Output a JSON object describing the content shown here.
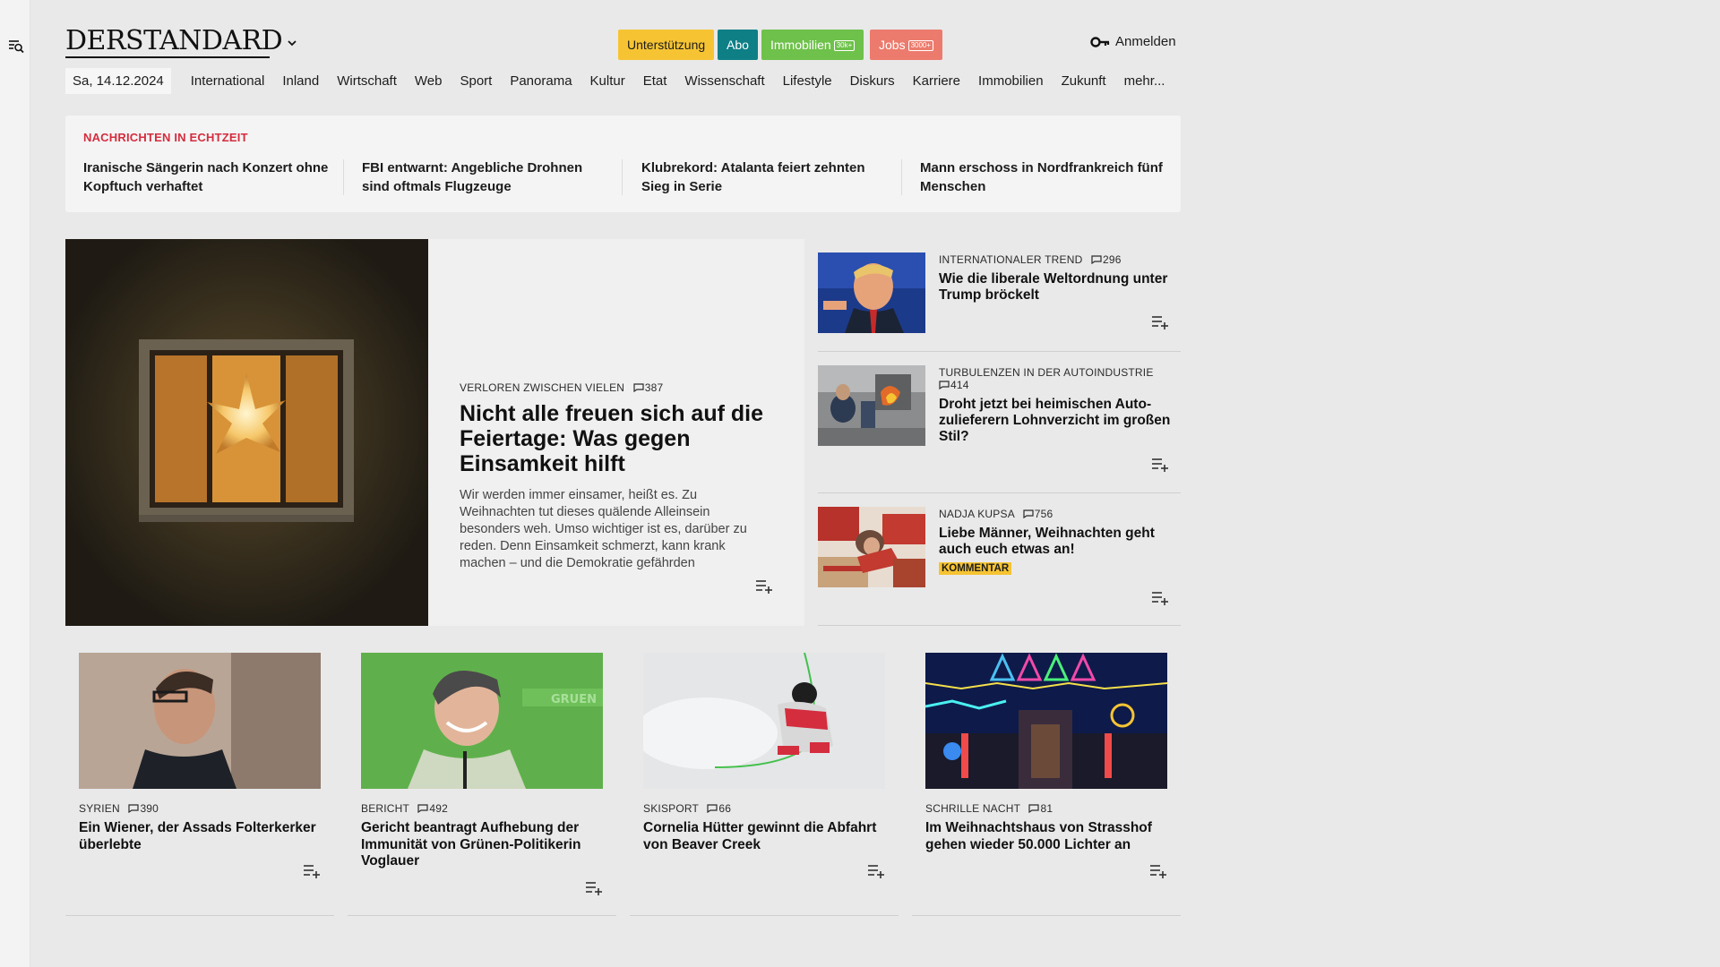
{
  "header": {
    "logo": "DERSTANDARD",
    "promos": {
      "support": "Unterstützung",
      "abo": "Abo",
      "immo": "Immobilien",
      "immo_badge": "30k+",
      "jobs": "Jobs",
      "jobs_badge": "3000+"
    },
    "login": "Anmelden"
  },
  "nav": {
    "date": "Sa, 14.12.2024",
    "items": [
      "International",
      "Inland",
      "Wirtschaft",
      "Web",
      "Sport",
      "Panorama",
      "Kultur",
      "Etat",
      "Wissenschaft",
      "Lifestyle",
      "Diskurs",
      "Karriere",
      "Immobilien",
      "Zukunft",
      "mehr..."
    ]
  },
  "ticker": {
    "heading": "Nachrichten in Echtzeit",
    "items": [
      "Iranische Sängerin nach Konzert ohne Kopftuch verhaftet",
      "FBI entwarnt: Angebliche Drohnen sind oftmals Flugzeuge",
      "Klubrekord: Atalanta feiert zehnten Sieg in Serie",
      "Mann erschoss in Nordfrankreich fünf Menschen"
    ]
  },
  "hero": {
    "kicker": "Verloren zwischen vielen",
    "comments": "387",
    "title": "Nicht alle freuen sich auf die Feiertage: Was gegen Einsamkeit hilft",
    "teaser": "Wir werden immer einsamer, heißt es. Zu Weihnachten tut dieses quälende Alleinsein besonders weh. Umso wichtiger ist es, darüber zu reden. Denn Einsamkeit schmerzt, kann krank machen – und die Demokratie gefährden"
  },
  "side": [
    {
      "kicker": "Internationaler Trend",
      "comments": "296",
      "title": "Wie die liberale Weltordnung unter Trump bröckelt"
    },
    {
      "kicker": "Turbulenzen in der Autoindustrie",
      "comments": "414",
      "title": "Droht jetzt bei heimischen Auto­zulieferern Lohnverzicht im großen Stil?"
    },
    {
      "kicker": "Nadja Kupsa",
      "comments": "756",
      "title": "Liebe Männer, Weihnachten geht auch euch etwas an!",
      "tag": "Kommentar"
    }
  ],
  "cards": [
    {
      "kicker": "Syrien",
      "comments": "390",
      "title": "Ein Wiener, der Assads Folterkerker überlebte"
    },
    {
      "kicker": "Bericht",
      "comments": "492",
      "title": "Gericht beantragt Aufhebung der Immunität von Grünen-Politikerin Voglauer"
    },
    {
      "kicker": "Skisport",
      "comments": "66",
      "title": "Cornelia Hütter gewinnt die Abfahrt von Beaver Creek"
    },
    {
      "kicker": "Schrille Nacht",
      "comments": "81",
      "title": "Im Weihnachtshaus von Strasshof gehen wieder 50.000 Lichter an"
    }
  ],
  "colors": {
    "ticker_heading": "#d42d3e",
    "support": "#f6c433",
    "abo": "#0f7f86",
    "immo": "#6ec14a",
    "jobs": "#ec7b6d"
  }
}
